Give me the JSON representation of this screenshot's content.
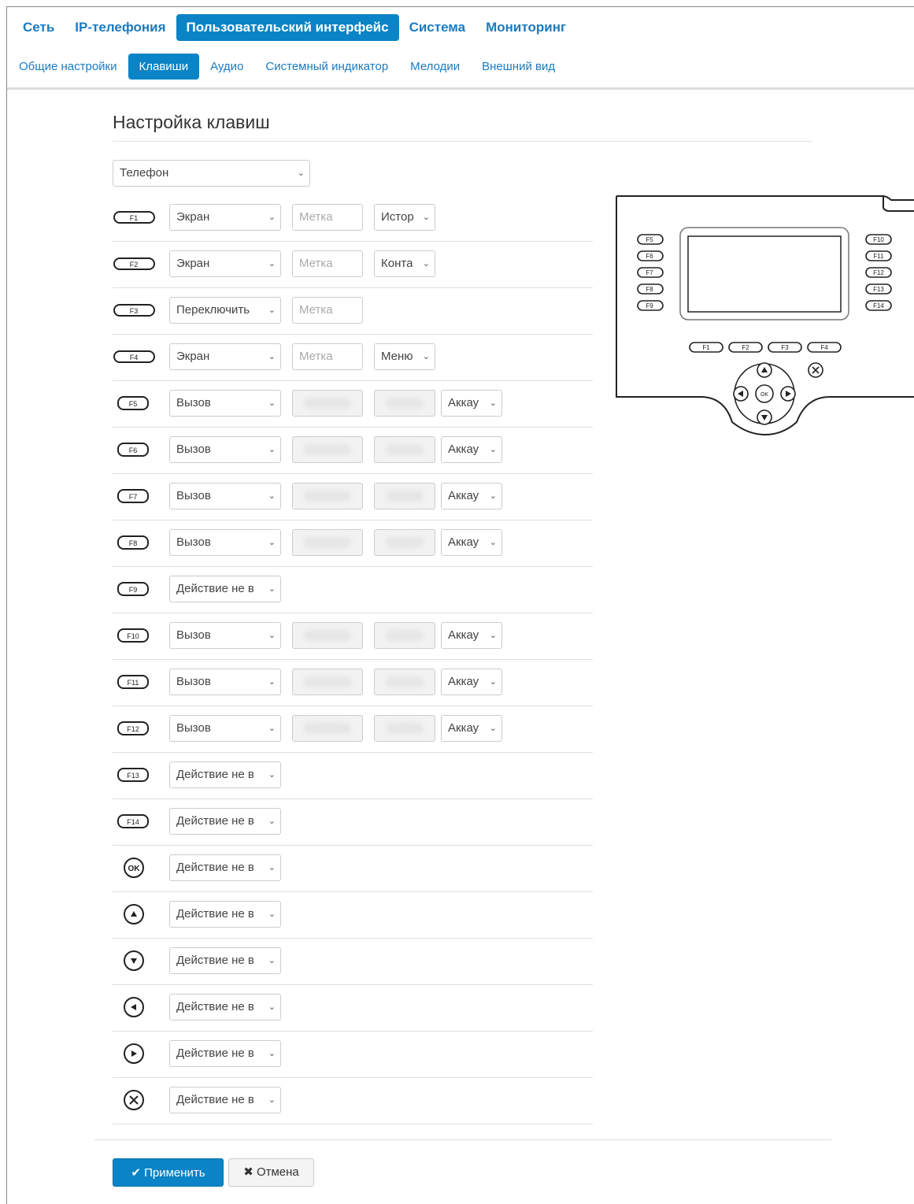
{
  "nav": {
    "items": [
      {
        "label": "Сеть",
        "active": false
      },
      {
        "label": "IP-телефония",
        "active": false
      },
      {
        "label": "Пользовательский интерфейс",
        "active": true
      },
      {
        "label": "Система",
        "active": false
      },
      {
        "label": "Мониторинг",
        "active": false
      }
    ]
  },
  "subnav": {
    "items": [
      {
        "label": "Общие настройки",
        "active": false
      },
      {
        "label": "Клавиши",
        "active": true
      },
      {
        "label": "Аудио",
        "active": false
      },
      {
        "label": "Системный индикатор",
        "active": false
      },
      {
        "label": "Мелодии",
        "active": false
      },
      {
        "label": "Внешний вид",
        "active": false
      }
    ]
  },
  "page": {
    "title": "Настройка клавиш",
    "device_select": "Телефон"
  },
  "keys": [
    {
      "key": "F1",
      "action": "Экран",
      "label_placeholder": "Метка",
      "extra": "Истор"
    },
    {
      "key": "F2",
      "action": "Экран",
      "label_placeholder": "Метка",
      "extra": "Конта"
    },
    {
      "key": "F3",
      "action": "Переключить",
      "label_placeholder": "Метка"
    },
    {
      "key": "F4",
      "action": "Экран",
      "label_placeholder": "Метка",
      "extra": "Меню"
    },
    {
      "key": "F5",
      "action": "Вызов",
      "account": "Аккау"
    },
    {
      "key": "F6",
      "action": "Вызов",
      "account": "Аккау"
    },
    {
      "key": "F7",
      "action": "Вызов",
      "account": "Аккау"
    },
    {
      "key": "F8",
      "action": "Вызов",
      "account": "Аккау"
    },
    {
      "key": "F9",
      "action": "Действие не в"
    },
    {
      "key": "F10",
      "action": "Вызов",
      "account": "Аккау"
    },
    {
      "key": "F11",
      "action": "Вызов",
      "account": "Аккау"
    },
    {
      "key": "F12",
      "action": "Вызов",
      "account": "Аккау"
    },
    {
      "key": "F13",
      "action": "Действие не в"
    },
    {
      "key": "F14",
      "action": "Действие не в"
    },
    {
      "key": "OK",
      "action": "Действие не в"
    },
    {
      "key": "up",
      "action": "Действие не в"
    },
    {
      "key": "down",
      "action": "Действие не в"
    },
    {
      "key": "left",
      "action": "Действие не в"
    },
    {
      "key": "right",
      "action": "Действие не в"
    },
    {
      "key": "cancel",
      "action": "Действие не в"
    }
  ],
  "phone_diagram": {
    "left_keys": [
      "F5",
      "F6",
      "F7",
      "F8",
      "F9"
    ],
    "right_keys": [
      "F10",
      "F11",
      "F12",
      "F13",
      "F14"
    ],
    "bottom_keys": [
      "F1",
      "F2",
      "F3",
      "F4"
    ],
    "ok_label": "OK"
  },
  "buttons": {
    "apply": "Применить",
    "cancel": "Отмена"
  },
  "colors": {
    "accent": "#0a84c6",
    "link": "#1a7bc1"
  }
}
